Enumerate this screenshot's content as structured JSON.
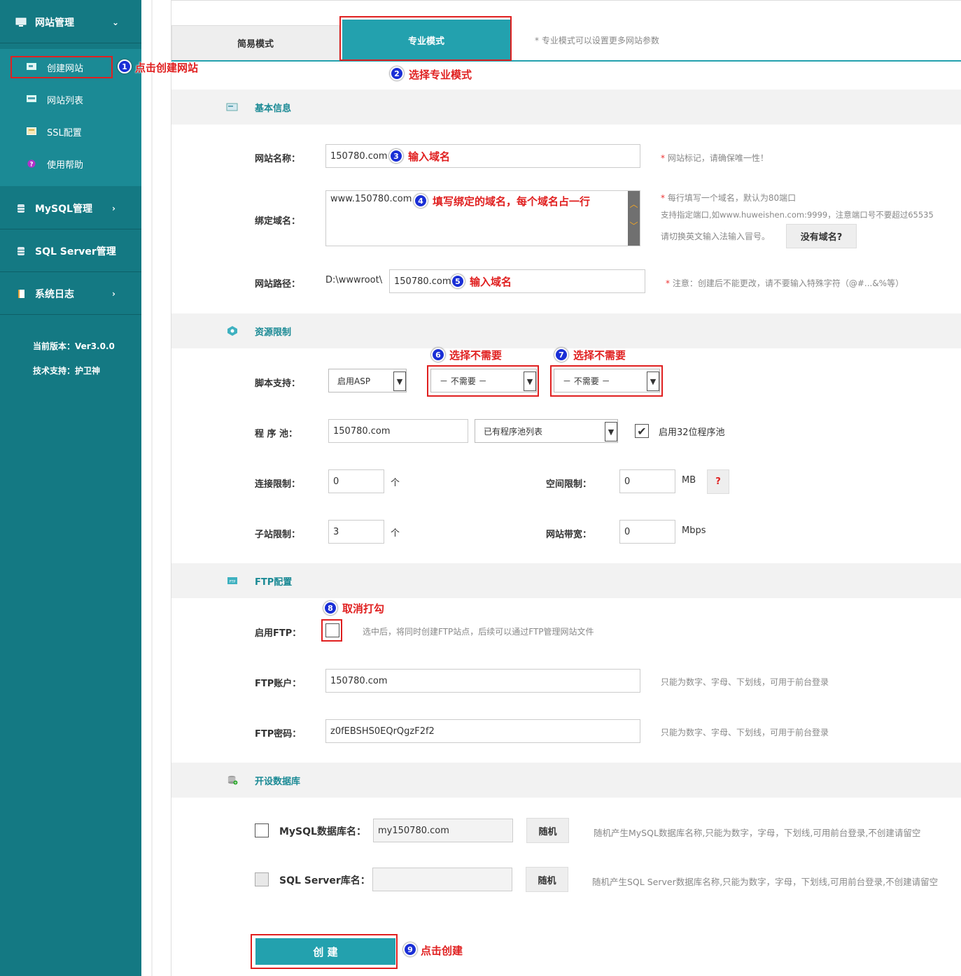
{
  "sidebar": {
    "site_mgmt": "网站管理",
    "items": [
      "创建网站",
      "网站列表",
      "SSL配置",
      "使用帮助"
    ],
    "mysql_mgmt": "MySQL管理",
    "sqlserver_mgmt": "SQL Server管理",
    "syslog": "系统日志",
    "version": "当前版本：Ver3.0.0",
    "support": "技术支持：护卫神"
  },
  "tabs": {
    "simple": "简易模式",
    "pro": "专业模式",
    "hint": "* 专业模式可以设置更多网站参数"
  },
  "basic": {
    "title": "基本信息",
    "name_label": "网站名称：",
    "name_value": "150780.com",
    "name_note_star": "*",
    "name_note": "网站标记，请确保唯一性！",
    "domain_label": "绑定域名：",
    "domain_value": "www.150780.com",
    "domain_note_star": "*",
    "domain_note1": "每行填写一个域名，默认为80端口",
    "domain_note2": "支持指定端口,如www.huweishen.com:9999，注意端口号不要超过65535",
    "domain_note3": "请切换英文输入法输入冒号。",
    "no_domain_btn": "没有域名?",
    "path_label": "网站路径：",
    "path_prefix": "D:\\wwwroot\\",
    "path_value": "150780.com",
    "path_note_star": "*",
    "path_note": "注意：创建后不能更改，请不要输入特殊字符（@#...&%等）"
  },
  "resource": {
    "title": "资源限制",
    "script_label": "脚本支持：",
    "script_sel1": "启用ASP",
    "script_sel2": "－ 不需要 －",
    "script_sel3": "－ 不需要 －",
    "pool_label": "程 序 池：",
    "pool_value": "150780.com",
    "pool_sel": "已有程序池列表",
    "pool32_label": "启用32位程序池",
    "conn_label": "连接限制：",
    "conn_value": "0",
    "conn_unit": "个",
    "space_label": "空间限制：",
    "space_value": "0",
    "space_unit": "MB",
    "space_help": "?",
    "sub_label": "子站限制：",
    "sub_value": "3",
    "sub_unit": "个",
    "bw_label": "网站带宽：",
    "bw_value": "0",
    "bw_unit": "Mbps"
  },
  "ftp": {
    "title": "FTP配置",
    "enable_label": "启用FTP：",
    "enable_note": "选中后，将同时创建FTP站点，后续可以通过FTP管理网站文件",
    "account_label": "FTP账户：",
    "account_value": "150780.com",
    "account_note": "只能为数字、字母、下划线，可用于前台登录",
    "pwd_label": "FTP密码：",
    "pwd_value": "z0fEBSHS0EQrQgzF2f2",
    "pwd_note": "只能为数字、字母、下划线，可用于前台登录"
  },
  "db": {
    "title": "开设数据库",
    "mysql_label": "MySQL数据库名：",
    "mysql_value": "my150780.com",
    "random1": "随机",
    "mysql_note": "随机产生MySQL数据库名称,只能为数字，字母，下划线,可用前台登录,不创建请留空",
    "sql_label": "SQL Server库名：",
    "random2": "随机",
    "sql_note": "随机产生SQL Server数据库名称,只能为数字，字母，下划线,可用前台登录,不创建请留空"
  },
  "create_btn": "创  建",
  "annotations": {
    "a1": "点击创建网站",
    "a2": "选择专业模式",
    "a3": "输入域名",
    "a4": "填写绑定的域名，每个域名占一行",
    "a5": "输入域名",
    "a6": "选择不需要",
    "a7": "选择不需要",
    "a8": "取消打勾",
    "a9": "点击创建"
  },
  "badges": [
    "1",
    "2",
    "3",
    "4",
    "5",
    "6",
    "7",
    "8",
    "9"
  ],
  "colors": {
    "sidebar": "#147983",
    "accent": "#1b8a95",
    "annotation": "#e02020",
    "badge": "#1a2fd6"
  }
}
